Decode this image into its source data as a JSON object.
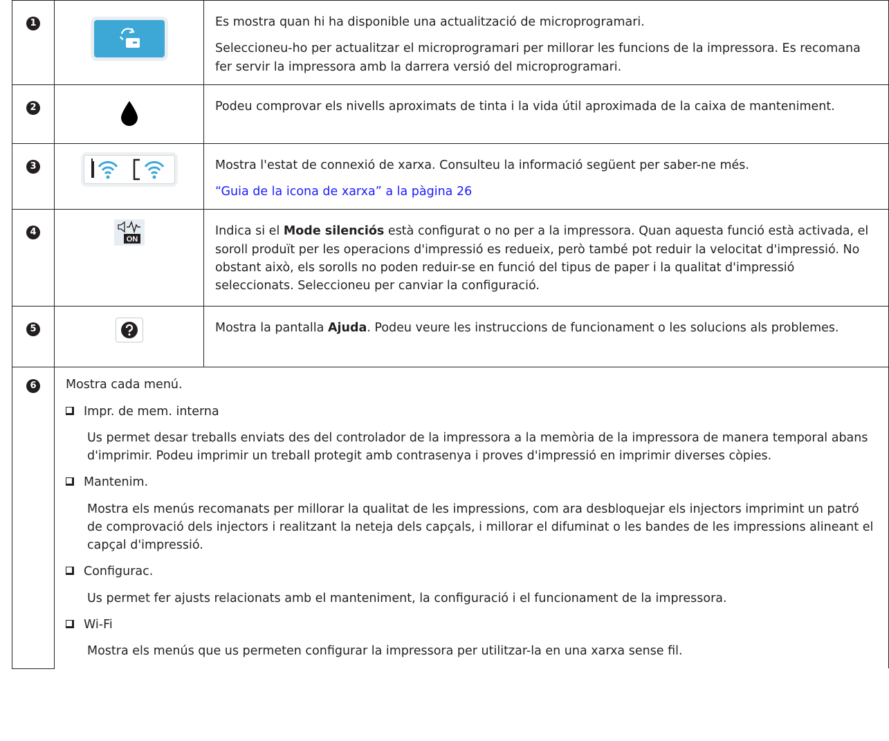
{
  "rows": [
    {
      "num": "1",
      "icon": "firmware-update-icon",
      "paragraphs": [
        "Es mostra quan hi ha disponible una actualització de microprogramari.",
        "Seleccioneu-ho per actualitzar el microprogramari per millorar les funcions de la impressora. Es recomana fer servir la impressora amb la darrera versió del microprogramari."
      ]
    },
    {
      "num": "2",
      "icon": "ink-drop-icon",
      "paragraphs": [
        "Podeu comprovar els nivells aproximats de tinta i la vida útil aproximada de la caixa de manteniment."
      ]
    },
    {
      "num": "3",
      "icon": "wifi-status-icon",
      "paragraphs": [
        "Mostra l'estat de connexió de xarxa. Consulteu la informació següent per saber-ne més."
      ],
      "link": "“Guia de la icona de xarxa” a la pàgina 26"
    },
    {
      "num": "4",
      "icon": "quiet-mode-icon",
      "icon_text": "ON",
      "text_before": "Indica si el ",
      "bold": "Mode silenciós",
      "text_after": " està configurat o no per a la impressora. Quan aquesta funció està activada, el soroll produït per les operacions d'impressió es redueix, però també pot reduir la velocitat d'impressió. No obstant això, els sorolls no poden reduir-se en funció del tipus de paper i la qualitat d'impressió seleccionats. Seleccioneu per canviar la configuració."
    },
    {
      "num": "5",
      "icon": "help-icon",
      "text_before": "Mostra la pantalla ",
      "bold": "Ajuda",
      "text_after": ". Podeu veure les instruccions de funcionament o les solucions als problemes."
    },
    {
      "num": "6",
      "intro": "Mostra cada menú.",
      "items": [
        {
          "label": "Impr. de mem. interna",
          "text": "Us permet desar treballs enviats des del controlador de la impressora a la memòria de la impressora de manera temporal abans d'imprimir. Podeu imprimir un treball protegit amb contrasenya i proves d'impressió en imprimir diverses còpies."
        },
        {
          "label": "Mantenim.",
          "text": "Mostra els menús recomanats per millorar la qualitat de les impressions, com ara desbloquejar els injectors imprimint un patró de comprovació dels injectors i realitzant la neteja dels capçals, i millorar el difuminat o les bandes de les impressions alineant el capçal d'impressió."
        },
        {
          "label": "Configurac.",
          "text": "Us permet fer ajusts relacionats amb el manteniment, la configuració i el funcionament de la impressora."
        },
        {
          "label": "Wi-Fi",
          "text": "Mostra els menús que us permeten configurar la impressora per utilitzar-la en una xarxa sense fil."
        }
      ]
    }
  ],
  "colors": {
    "link": "#1a1aff",
    "icon_blue": "#3da7d6",
    "text": "#231f20"
  }
}
